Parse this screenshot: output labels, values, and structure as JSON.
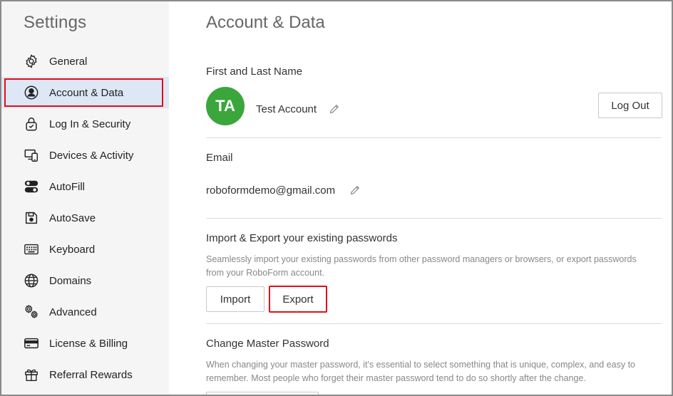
{
  "sidebar": {
    "title": "Settings",
    "items": [
      {
        "label": "General",
        "icon": "gear-icon"
      },
      {
        "label": "Account & Data",
        "icon": "user-circle-icon",
        "active": true
      },
      {
        "label": "Log In & Security",
        "icon": "lock-check-icon"
      },
      {
        "label": "Devices & Activity",
        "icon": "devices-icon"
      },
      {
        "label": "AutoFill",
        "icon": "toggles-icon"
      },
      {
        "label": "AutoSave",
        "icon": "floppy-disk-icon"
      },
      {
        "label": "Keyboard",
        "icon": "keyboard-icon"
      },
      {
        "label": "Domains",
        "icon": "globe-icon"
      },
      {
        "label": "Advanced",
        "icon": "gears-icon"
      },
      {
        "label": "License & Billing",
        "icon": "credit-card-icon"
      },
      {
        "label": "Referral Rewards",
        "icon": "gift-icon"
      }
    ]
  },
  "main": {
    "title": "Account & Data",
    "name_section": {
      "label": "First and Last Name",
      "avatar_initials": "TA",
      "avatar_color": "#3aa63b",
      "name": "Test Account",
      "logout_label": "Log Out"
    },
    "email_section": {
      "label": "Email",
      "email": "roboformdemo@gmail.com"
    },
    "import_export": {
      "label": "Import & Export your existing passwords",
      "description": "Seamlessly import your existing passwords from other password managers or browsers, or export passwords from your RoboForm account.",
      "import_label": "Import",
      "export_label": "Export"
    },
    "master_password": {
      "label": "Change Master Password",
      "description": "When changing your master password, it's essential to select something that is unique, complex, and easy to remember. Most people who forget their master password tend to do so shortly after the change."
    }
  },
  "colors": {
    "highlight": "#e0101a",
    "active_bg": "#dde7f6"
  }
}
